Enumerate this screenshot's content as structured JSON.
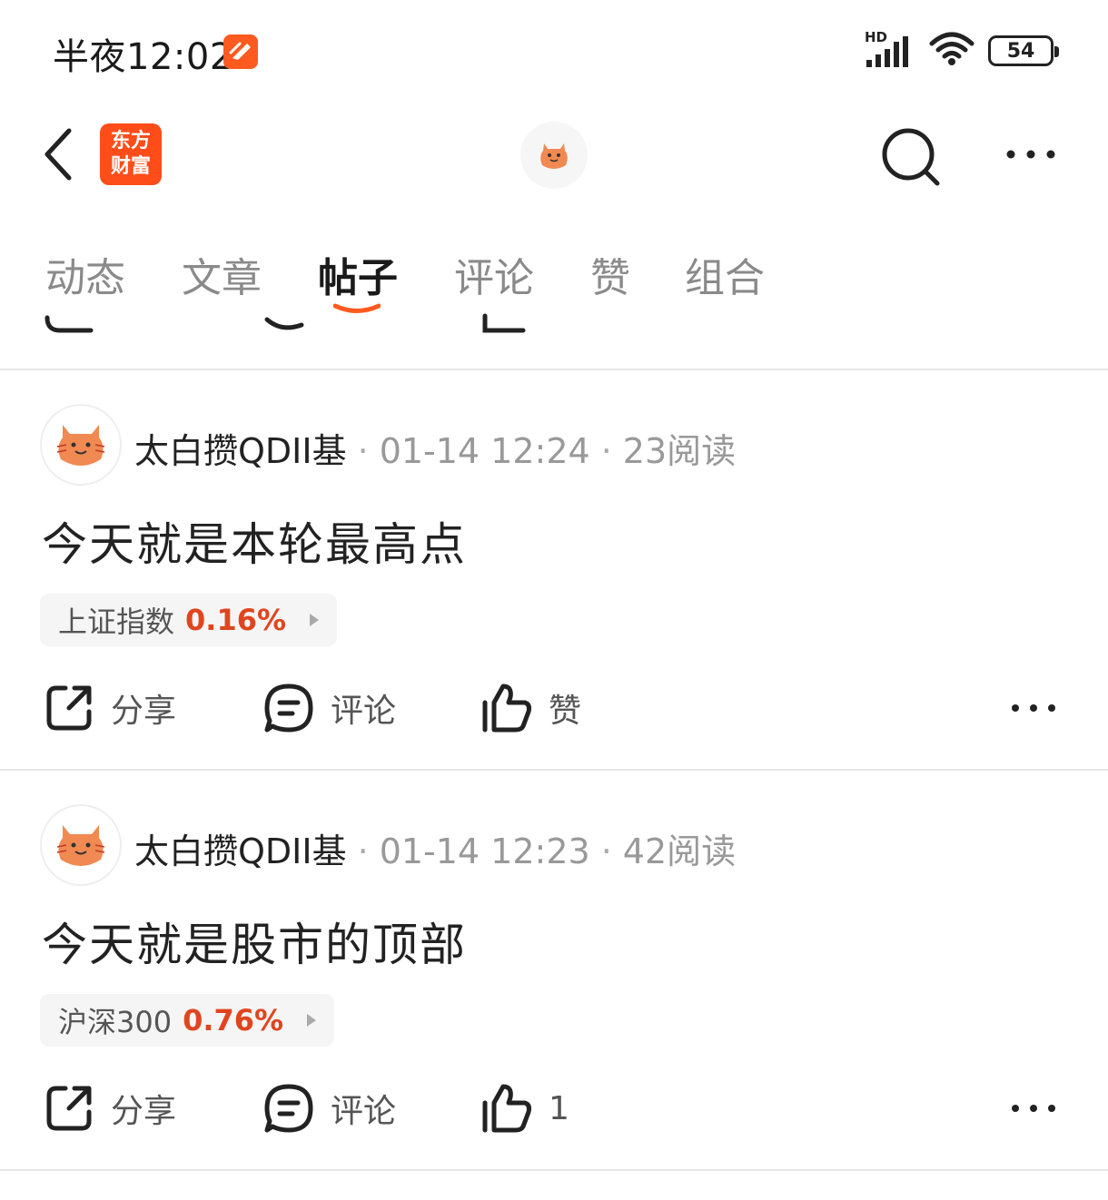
{
  "status_bar": {
    "time": "半夜12:02",
    "network_badge": "HD",
    "battery_level": "54",
    "icons": [
      "app-notification-icon",
      "signal-icon",
      "wifi-icon",
      "battery-icon"
    ]
  },
  "top_nav": {
    "brand_line1": "东方",
    "brand_line2": "财富",
    "icons": [
      "back-icon",
      "avatar-icon",
      "search-icon",
      "more-icon"
    ]
  },
  "tabs": [
    {
      "label": "动态",
      "active": false
    },
    {
      "label": "文章",
      "active": false
    },
    {
      "label": "帖子",
      "active": true
    },
    {
      "label": "评论",
      "active": false
    },
    {
      "label": "赞",
      "active": false
    },
    {
      "label": "组合",
      "active": false
    }
  ],
  "accent_color": "#ff4d1a",
  "rise_color": "#e0451f",
  "posts": [
    {
      "author": "太白攒QDII基",
      "time": "01-14 12:24",
      "reads": "23阅读",
      "separator": "·",
      "title": "今天就是本轮最高点",
      "stock_name": "上证指数",
      "stock_change": "0.16%",
      "actions": {
        "share": "分享",
        "comment": "评论",
        "like": "赞"
      }
    },
    {
      "author": "太白攒QDII基",
      "time": "01-14 12:23",
      "reads": "42阅读",
      "separator": "·",
      "title": "今天就是股市的顶部",
      "stock_name": "沪深300",
      "stock_change": "0.76%",
      "actions": {
        "share": "分享",
        "comment": "评论",
        "like": "1"
      }
    }
  ]
}
